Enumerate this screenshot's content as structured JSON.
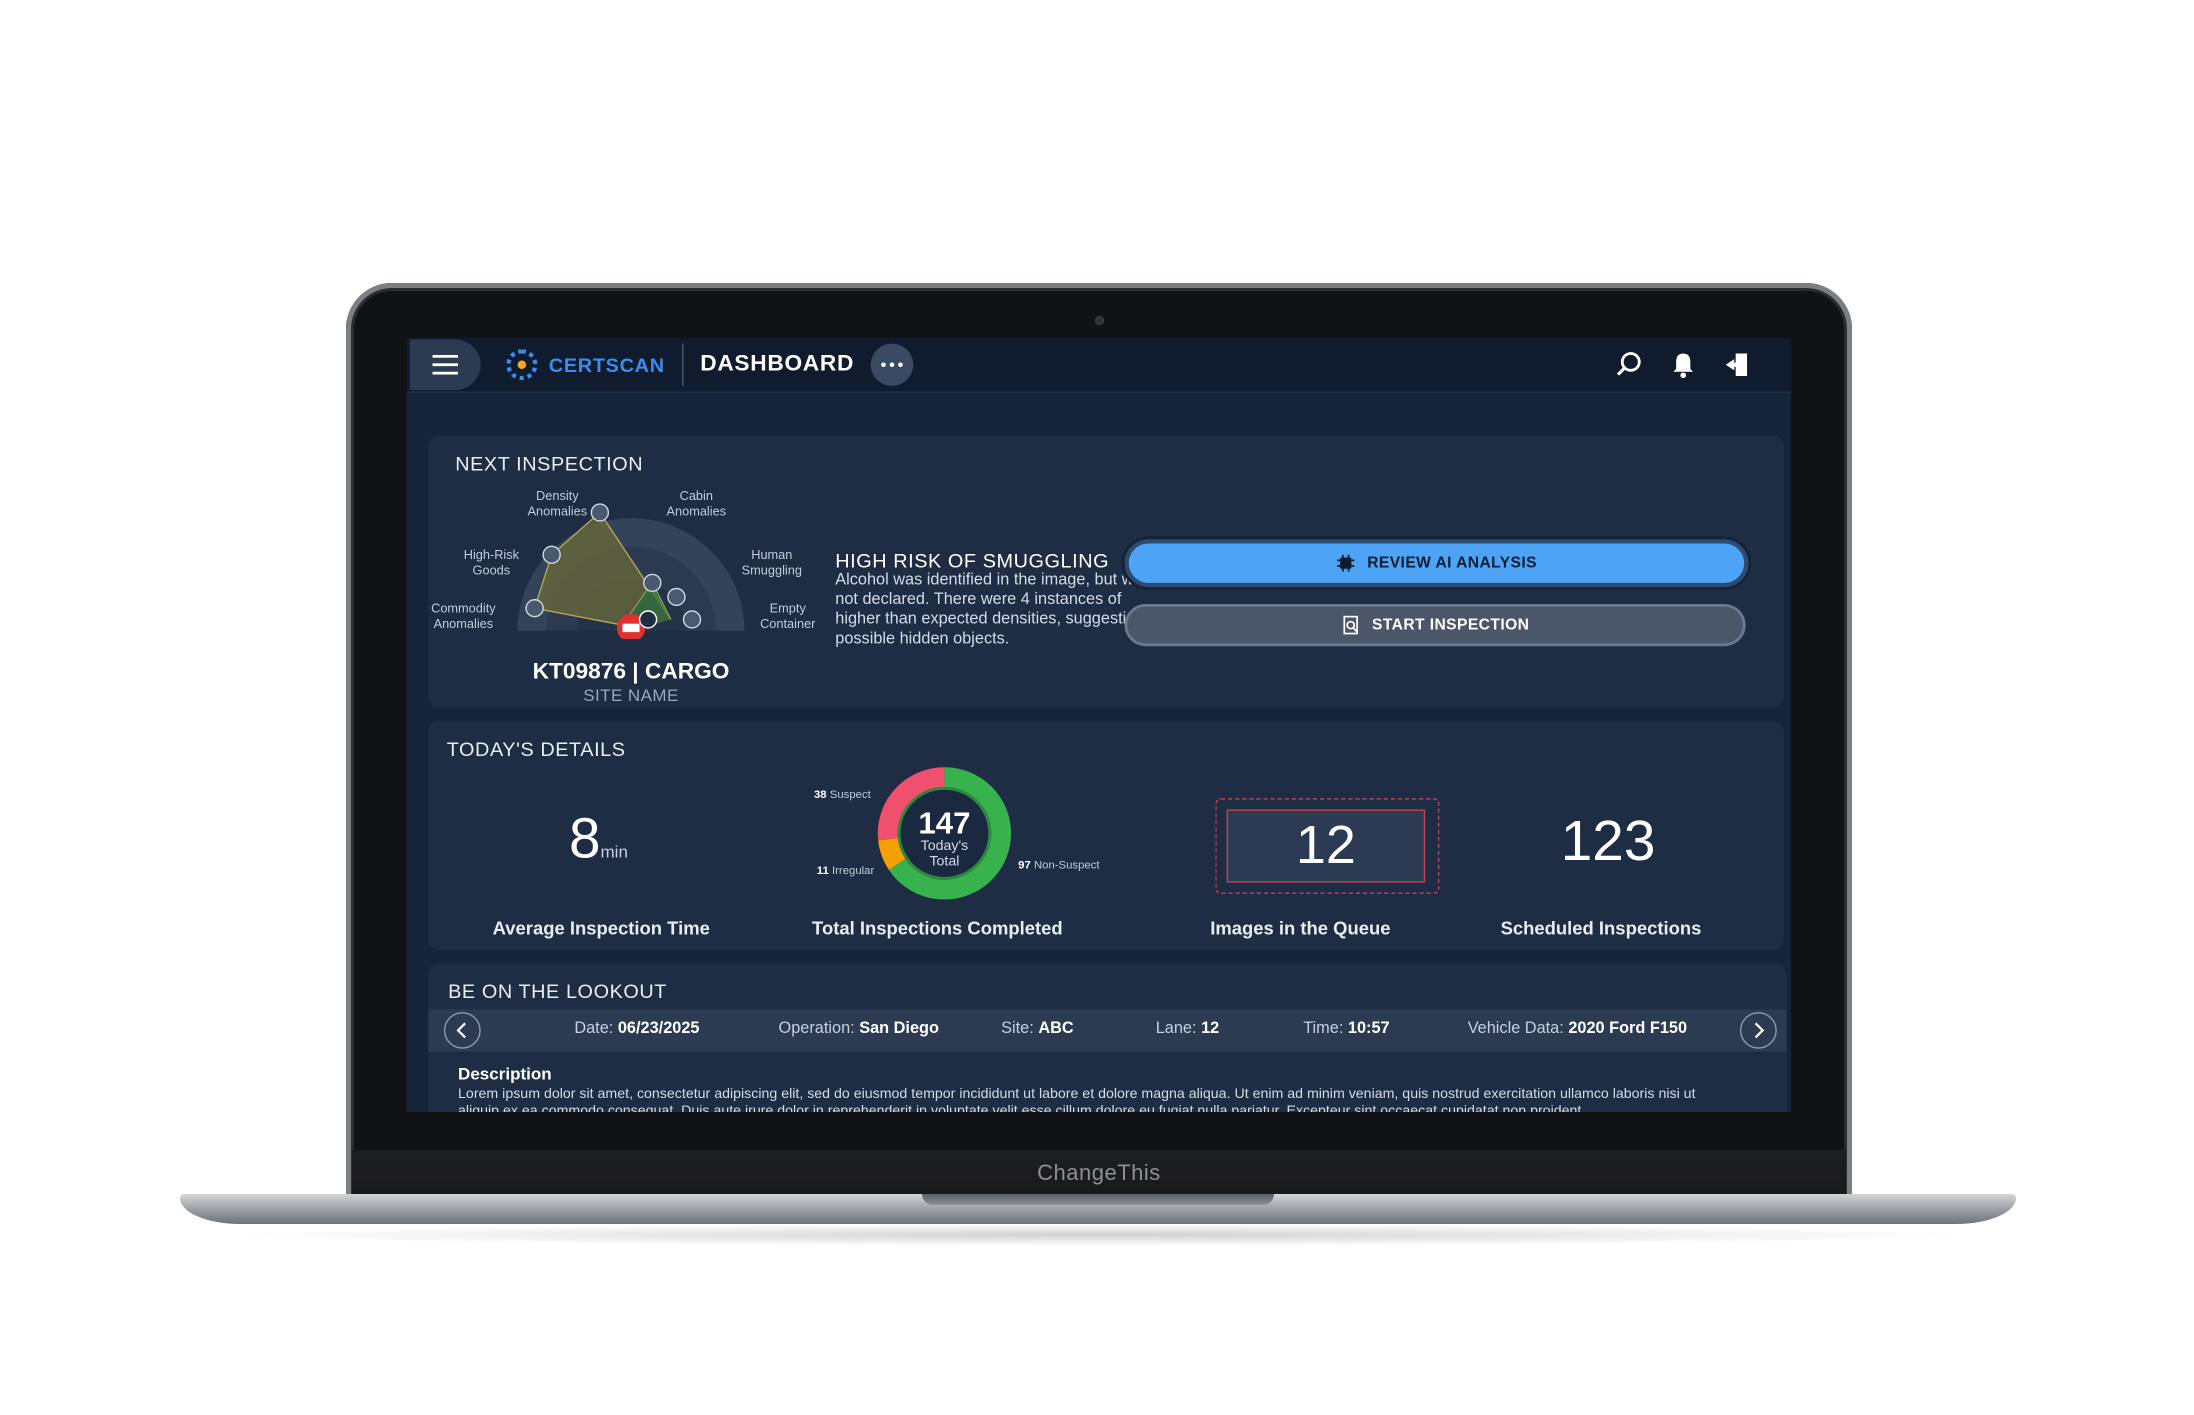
{
  "device": {
    "label": "ChangeThis"
  },
  "header": {
    "logo_text": "CERTSCAN",
    "page_title": "DASHBOARD"
  },
  "next_inspection": {
    "title": "NEXT INSPECTION",
    "radar_labels": {
      "density": "Density\nAnomalies",
      "cabin": "Cabin\nAnomalies",
      "high_risk": "High-Risk\nGoods",
      "human": "Human\nSmuggling",
      "commodity": "Commodity\nAnomalies",
      "empty": "Empty\nContainer"
    },
    "site_id": "KT09876 | CARGO",
    "site_name": "SITE NAME",
    "risk_title": "HIGH RISK OF SMUGGLING",
    "risk_text": "Alcohol was identified in the image, but was not declared. There were 4 instances of higher than expected densities, suggesting possible hidden objects.",
    "review_button": "REVIEW AI ANALYSIS",
    "start_button": "START INSPECTION",
    "colors": {
      "radar_fill": "#6b6a3a",
      "risk_marker": "#e03131",
      "primary": "#4da3f5"
    }
  },
  "todays_details": {
    "title": "TODAY'S DETAILS",
    "avg_time": {
      "value": "8",
      "unit": "min",
      "caption": "Average Inspection Time"
    },
    "total": {
      "value": "147",
      "sublabel": "Today's\nTotal",
      "caption": "Total Inspections Completed",
      "suspect": {
        "count": "38",
        "label": "Suspect"
      },
      "irregular": {
        "count": "11",
        "label": "Irregular"
      },
      "non_suspect": {
        "count": "97",
        "label": "Non-Suspect"
      },
      "colors": {
        "suspect": "#f0506e",
        "irregular": "#f59f00",
        "non_suspect": "#37b24d"
      }
    },
    "queue": {
      "value": "12",
      "caption": "Images in the Queue"
    },
    "scheduled": {
      "value": "123",
      "caption": "Scheduled Inspections"
    }
  },
  "lookout": {
    "title": "BE ON THE LOOKOUT",
    "date_label": "Date:",
    "date": "06/23/2025",
    "operation_label": "Operation:",
    "operation": "San Diego",
    "site_label": "Site:",
    "site": "ABC",
    "lane_label": "Lane:",
    "lane": "12",
    "time_label": "Time:",
    "time": "10:57",
    "vehicle_label": "Vehicle Data:",
    "vehicle": "2020 Ford F150",
    "description_title": "Description",
    "description": "Lorem ipsum dolor sit amet, consectetur adipiscing elit, sed do eiusmod tempor incididunt ut labore et dolore magna aliqua. Ut enim ad minim veniam, quis nostrud exercitation ullamco laboris nisi ut aliquip ex ea commodo consequat. Duis aute irure dolor in reprehenderit in voluptate velit esse cillum dolore eu fugiat nulla pariatur. Excepteur sint occaecat cupidatat non proident."
  }
}
